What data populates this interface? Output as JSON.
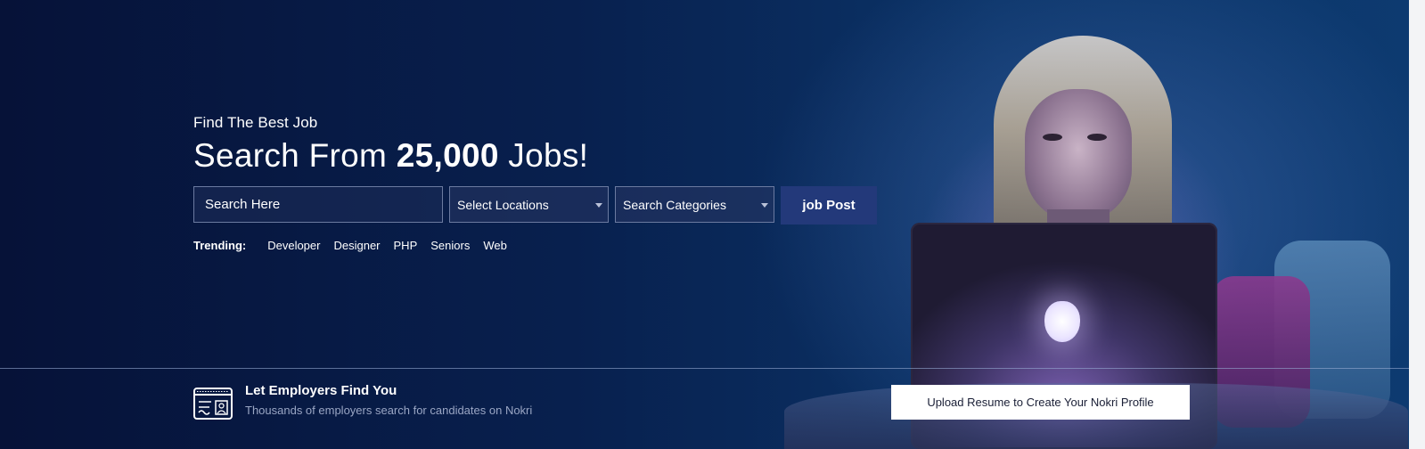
{
  "hero": {
    "subtitle": "Find The Best Job",
    "headline_prefix": "Search From",
    "headline_number": "25,000",
    "headline_suffix": "Jobs!"
  },
  "search": {
    "placeholder": "Search Here",
    "location_select": "Select Locations",
    "category_select": "Search Categories",
    "submit_label": "job Post"
  },
  "trending": {
    "label": "Trending:",
    "tags": [
      "Developer",
      "Designer",
      "PHP",
      "Seniors",
      "Web"
    ]
  },
  "cta": {
    "title": "Let Employers Find You",
    "subtitle": "Thousands of employers search for candidates on Nokri",
    "button_label": "Upload Resume to Create Your Nokri Profile"
  },
  "colors": {
    "background": "#06123a",
    "button_primary": "#23397a",
    "button_secondary": "#ffffff"
  }
}
